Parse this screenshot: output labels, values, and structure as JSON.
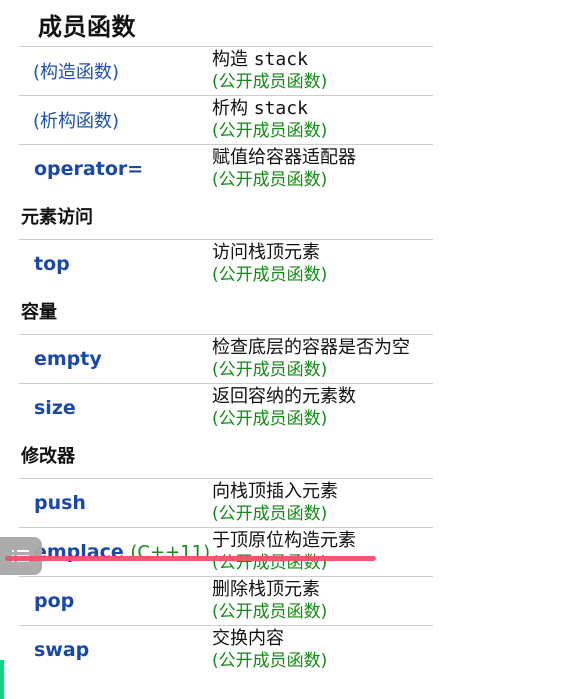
{
  "page_title": "成员函数",
  "kind_label": "(公开成员函数)",
  "member_groups": [
    {
      "section": "",
      "rows": [
        {
          "name": "(构造函数)",
          "since": "",
          "desc_prefix": "构造 ",
          "desc_code": "stack",
          "desc": ""
        },
        {
          "name": "(析构函数)",
          "since": "",
          "desc_prefix": "析构 ",
          "desc_code": "stack",
          "desc": ""
        },
        {
          "name": "operator=",
          "since": "",
          "desc_prefix": "",
          "desc_code": "",
          "desc": "赋值给容器适配器"
        }
      ]
    },
    {
      "section": "元素访问",
      "rows": [
        {
          "name": "top",
          "since": "",
          "desc": "访问栈顶元素"
        }
      ]
    },
    {
      "section": "容量",
      "rows": [
        {
          "name": "empty",
          "since": "",
          "desc": "检查底层的容器是否为空"
        },
        {
          "name": "size",
          "since": "",
          "desc": "返回容纳的元素数"
        }
      ]
    },
    {
      "section": "修改器",
      "rows": [
        {
          "name": "push",
          "since": "",
          "desc": "向栈顶插入元素"
        },
        {
          "name": "emplace",
          "since": "(C++11)",
          "desc": "于顶原位构造元素"
        },
        {
          "name": "pop",
          "since": "",
          "desc": "删除栈顶元素"
        },
        {
          "name": "swap",
          "since": "",
          "desc": "交换内容"
        }
      ]
    }
  ],
  "overlays": {
    "float_button_icon": "list-icon",
    "annotation_color": "#f0506a",
    "accent_bar_color": "#12d483"
  }
}
